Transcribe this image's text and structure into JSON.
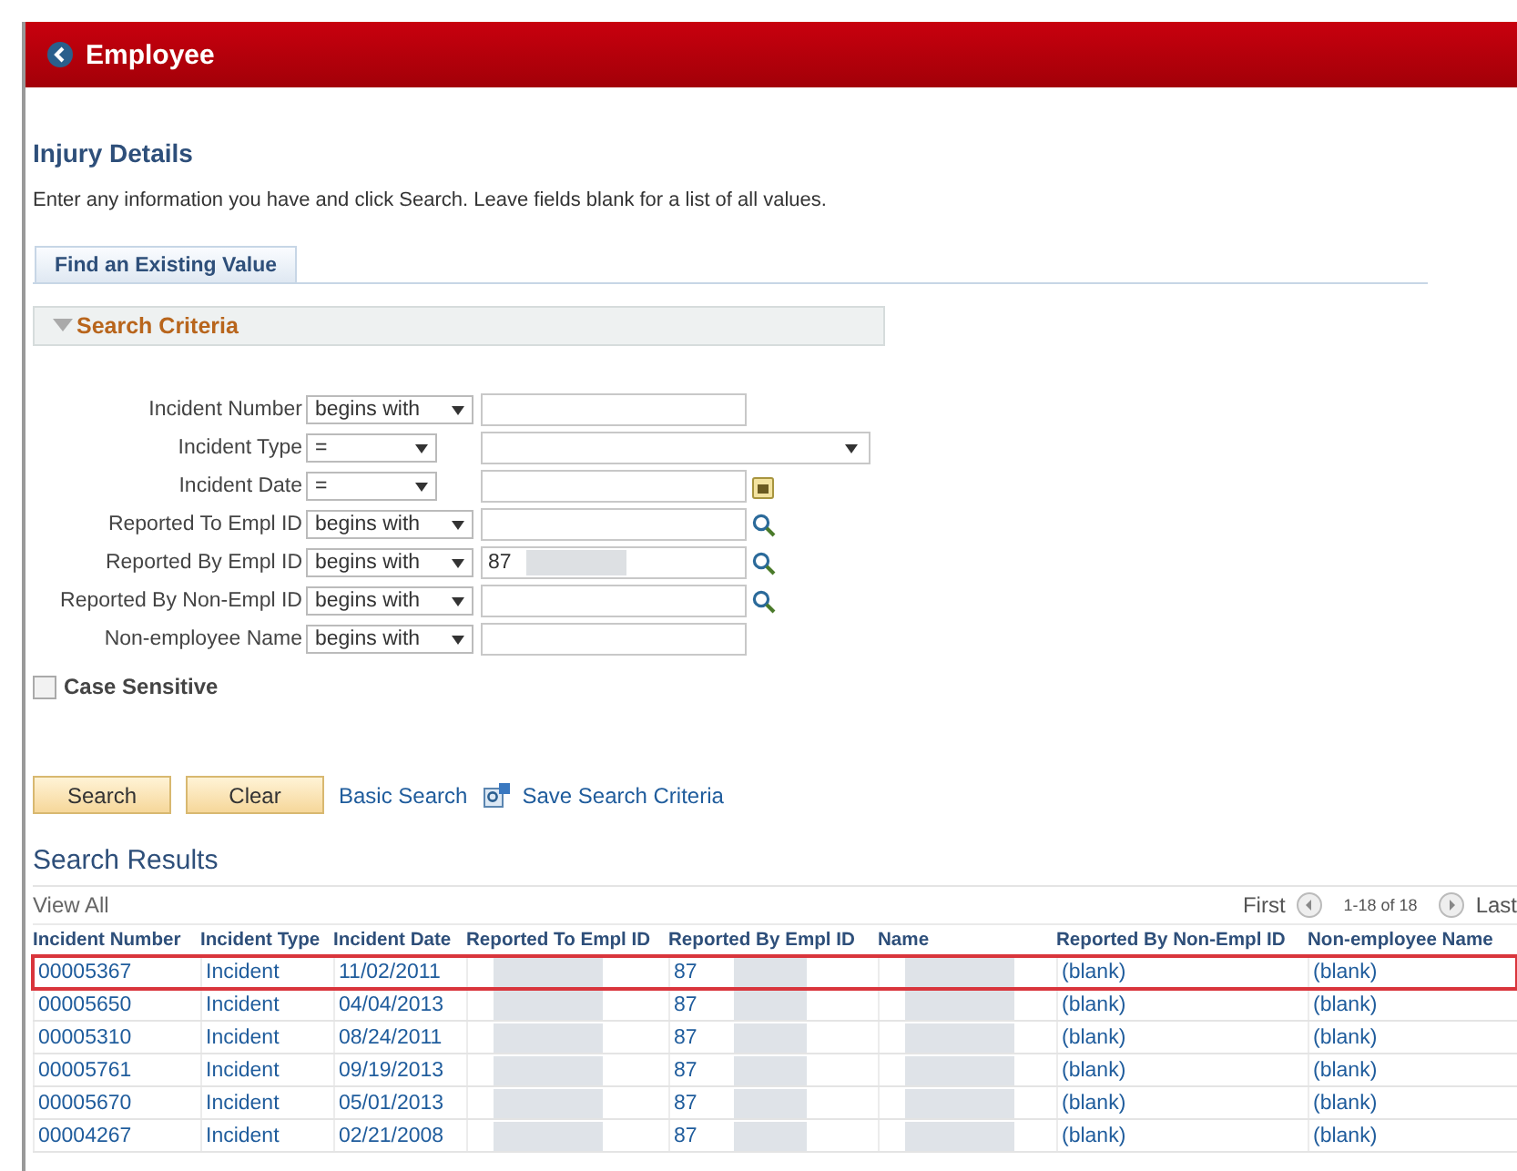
{
  "header": {
    "title": "Employee"
  },
  "page": {
    "title": "Injury Details",
    "instructions": "Enter any information you have and click Search. Leave fields blank for a list of all values."
  },
  "tabs": [
    {
      "label": "Find an Existing Value",
      "selected": true
    }
  ],
  "criteria": {
    "title": "Search Criteria",
    "expanded": true,
    "fields": [
      {
        "label": "Incident Number",
        "operator": "begins with",
        "kind": "text"
      },
      {
        "label": "Incident Type",
        "operator": "=",
        "kind": "select"
      },
      {
        "label": "Incident Date",
        "operator": "=",
        "kind": "date"
      },
      {
        "label": "Reported To Empl ID",
        "operator": "begins with",
        "kind": "lookup"
      },
      {
        "label": "Reported By Empl ID",
        "operator": "begins with",
        "kind": "lookup",
        "value": "87",
        "redacted": true
      },
      {
        "label": "Reported By Non-Empl ID",
        "operator": "begins with",
        "kind": "lookup"
      },
      {
        "label": "Non-employee Name",
        "operator": "begins with",
        "kind": "text"
      }
    ],
    "case_sensitive": {
      "label": "Case Sensitive",
      "checked": false
    }
  },
  "buttons": [
    "Search",
    "Clear"
  ],
  "links": [
    "Basic Search",
    "Save Search Criteria"
  ],
  "results": {
    "title": "Search Results",
    "view_all": "View All",
    "first": "First",
    "range": "1-18 of 18",
    "last": "Last",
    "columns": [
      {
        "label": "Incident Number",
        "kind": "text"
      },
      {
        "label": "Incident Type",
        "kind": "text"
      },
      {
        "label": "Incident Date",
        "kind": "text"
      },
      {
        "label": "Reported To Empl ID",
        "kind": "redacted"
      },
      {
        "label": "Reported By Empl ID",
        "kind": "partial"
      },
      {
        "label": "Name",
        "kind": "redacted"
      },
      {
        "label": "Reported By Non-Empl ID",
        "kind": "text"
      },
      {
        "label": "Non-employee Name",
        "kind": "text"
      }
    ],
    "rows": [
      {
        "cells": [
          "00005367",
          "Incident",
          "11/02/2011",
          "",
          "87",
          "",
          "(blank)",
          "(blank)"
        ],
        "selected": true
      },
      {
        "cells": [
          "00005650",
          "Incident",
          "04/04/2013",
          "",
          "87",
          "",
          "(blank)",
          "(blank)"
        ],
        "selected": false
      },
      {
        "cells": [
          "00005310",
          "Incident",
          "08/24/2011",
          "",
          "87",
          "",
          "(blank)",
          "(blank)"
        ],
        "selected": false
      },
      {
        "cells": [
          "00005761",
          "Incident",
          "09/19/2013",
          "",
          "87",
          "",
          "(blank)",
          "(blank)"
        ],
        "selected": false
      },
      {
        "cells": [
          "00005670",
          "Incident",
          "05/01/2013",
          "",
          "87",
          "",
          "(blank)",
          "(blank)"
        ],
        "selected": false
      },
      {
        "cells": [
          "00004267",
          "Incident",
          "02/21/2008",
          "",
          "87",
          "",
          "(blank)",
          "(blank)"
        ],
        "selected": false
      }
    ]
  }
}
